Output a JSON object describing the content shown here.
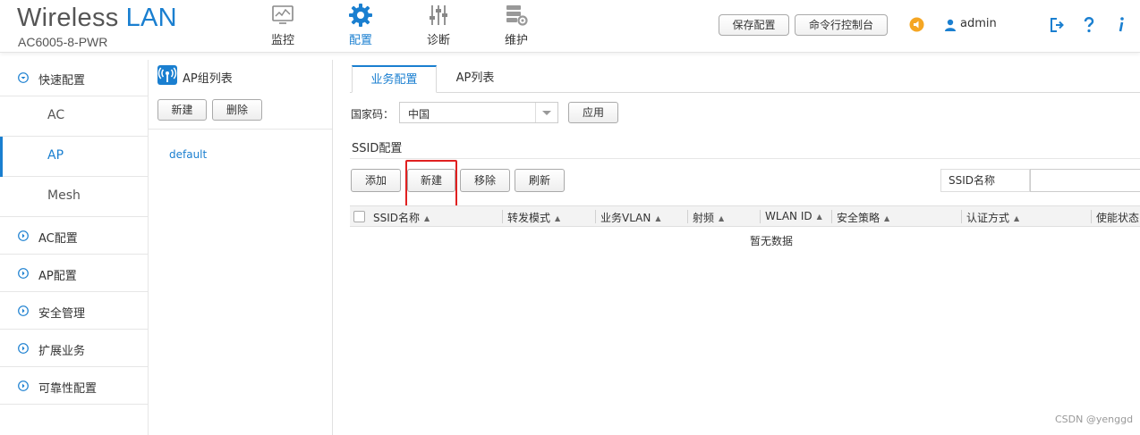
{
  "brand": {
    "name": "Wireless",
    "name_accent": "LAN",
    "model": "AC6005-8-PWR"
  },
  "nav": [
    {
      "label": "监控",
      "icon": "monitor-icon"
    },
    {
      "label": "配置",
      "icon": "gear-icon",
      "active": true
    },
    {
      "label": "诊断",
      "icon": "diagnose-sliders-icon"
    },
    {
      "label": "维护",
      "icon": "maintenance-server-icon"
    }
  ],
  "header": {
    "save_config": "保存配置",
    "cli_console": "命令行控制台",
    "user": "admin"
  },
  "sidebar": {
    "quick_config": "快速配置",
    "sub": [
      "AC",
      "AP",
      "Mesh"
    ],
    "active_sub": "AP",
    "groups": [
      "AC配置",
      "AP配置",
      "安全管理",
      "扩展业务",
      "可靠性配置"
    ]
  },
  "ap_group": {
    "title": "AP组列表",
    "new_button": "新建",
    "delete_button": "删除",
    "items": [
      "default"
    ]
  },
  "main": {
    "tabs": [
      "业务配置",
      "AP列表"
    ],
    "active_tab": "业务配置",
    "country_label": "国家码：",
    "country_value": "中国",
    "apply_button": "应用",
    "section_title": "SSID配置",
    "toolbar": {
      "add": "添加",
      "new": "新建",
      "remove": "移除",
      "refresh": "刷新"
    },
    "search_label": "SSID名称",
    "columns": [
      "SSID名称",
      "转发模式",
      "业务VLAN",
      "射频",
      "WLAN ID",
      "安全策略",
      "认证方式",
      "使能状态"
    ],
    "empty_text": "暂无数据"
  },
  "watermark": "CSDN @yenggd",
  "colors": {
    "accent": "#1a7fd0",
    "highlight": "#e02020",
    "warning": "#f5a623"
  }
}
